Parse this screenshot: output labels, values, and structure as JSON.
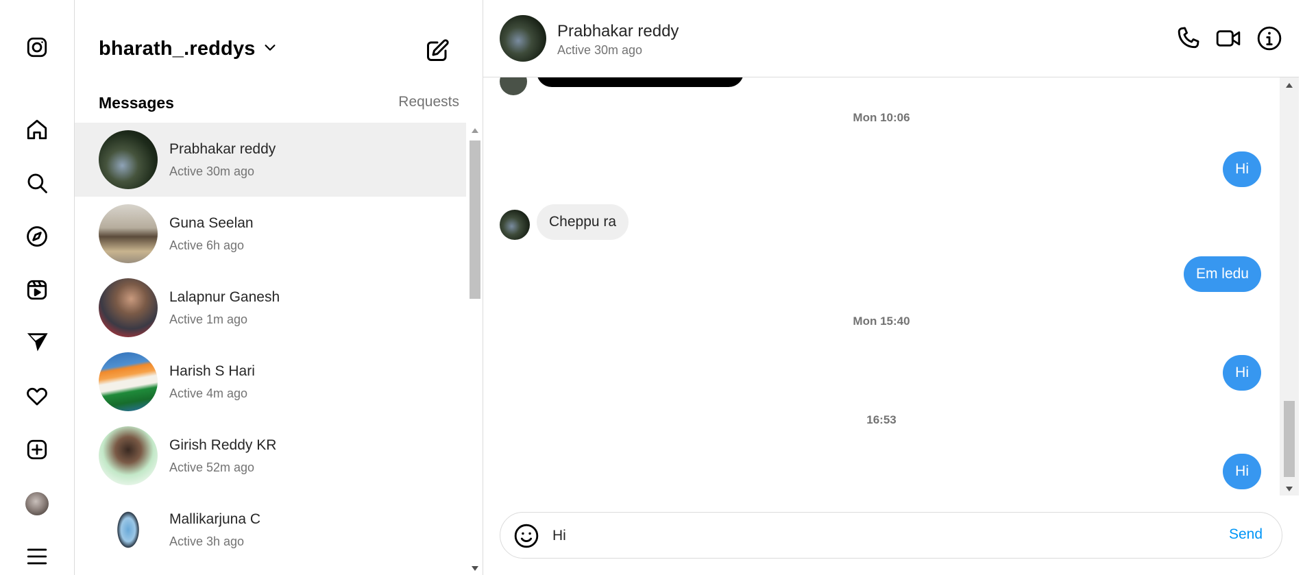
{
  "colors": {
    "outgoing_bubble": "#3797f0",
    "incoming_bubble": "#efefef",
    "send_link": "#0095f6",
    "selected_row": "#efefef",
    "secondary_text": "#737373"
  },
  "nav": {
    "items": [
      {
        "icon": "instagram-logo-icon"
      },
      {
        "icon": "home-icon"
      },
      {
        "icon": "search-icon"
      },
      {
        "icon": "explore-compass-icon"
      },
      {
        "icon": "reels-icon"
      },
      {
        "icon": "direct-messages-icon"
      },
      {
        "icon": "notifications-heart-icon"
      },
      {
        "icon": "create-plus-icon"
      },
      {
        "icon": "profile-avatar"
      },
      {
        "icon": "more-menu-icon"
      }
    ]
  },
  "inbox": {
    "account_name": "bharath_.reddys",
    "tabs": {
      "messages": "Messages",
      "requests": "Requests"
    },
    "threads": [
      {
        "name": "Prabhakar reddy",
        "status": "Active 30m ago",
        "selected": true
      },
      {
        "name": "Guna Seelan",
        "status": "Active 6h ago",
        "selected": false
      },
      {
        "name": "Lalapnur Ganesh",
        "status": "Active 1m ago",
        "selected": false
      },
      {
        "name": "Harish S Hari",
        "status": "Active 4m ago",
        "selected": false
      },
      {
        "name": "Girish Reddy KR",
        "status": "Active 52m ago",
        "selected": false
      },
      {
        "name": "Mallikarjuna C",
        "status": "Active 3h ago",
        "selected": false
      }
    ]
  },
  "chat": {
    "contact_name": "Prabhakar reddy",
    "contact_status": "Active 30m ago",
    "header_icons": [
      "phone-icon",
      "video-call-icon",
      "info-icon"
    ],
    "messages": [
      {
        "kind": "timestamp",
        "text": "Mon 10:06"
      },
      {
        "kind": "outgoing",
        "text": "Hi"
      },
      {
        "kind": "incoming",
        "text": "Cheppu ra"
      },
      {
        "kind": "outgoing",
        "text": "Em ledu"
      },
      {
        "kind": "timestamp",
        "text": "Mon 15:40"
      },
      {
        "kind": "outgoing",
        "text": "Hi"
      },
      {
        "kind": "timestamp",
        "text": "16:53"
      },
      {
        "kind": "outgoing",
        "text": "Hi"
      }
    ],
    "composer": {
      "value": "Hi",
      "send_label": "Send"
    }
  }
}
